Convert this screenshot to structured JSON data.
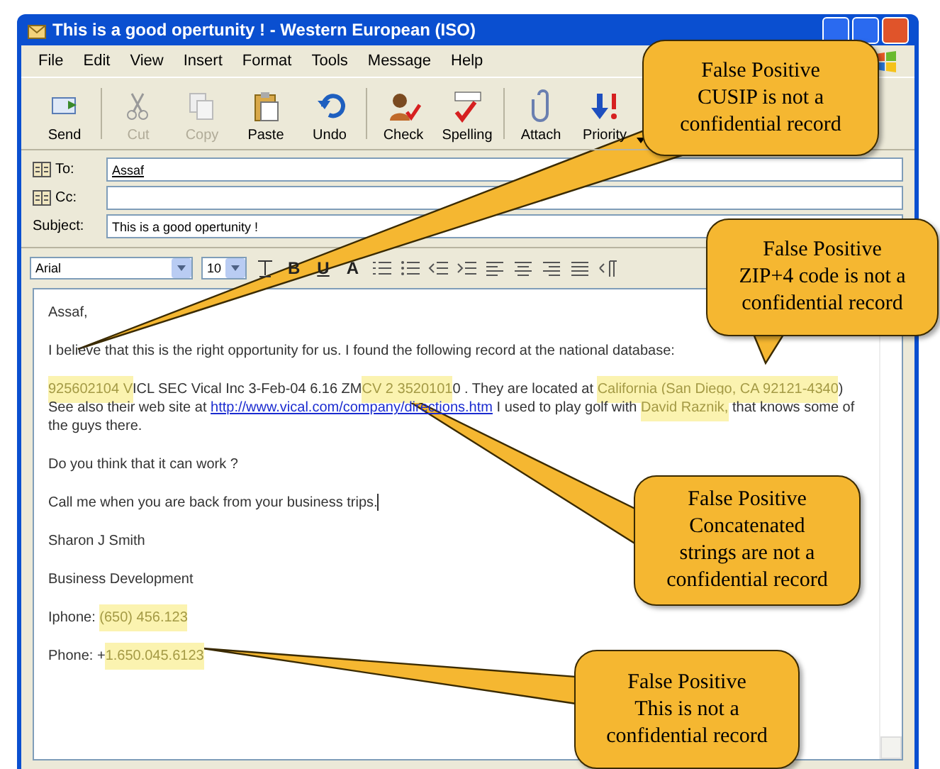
{
  "window": {
    "title": "This is a good opertunity ! - Western European (ISO)"
  },
  "menu": [
    "File",
    "Edit",
    "View",
    "Insert",
    "Format",
    "Tools",
    "Message",
    "Help"
  ],
  "toolbar": [
    {
      "label": "Send",
      "disabled": false,
      "separator_before": false
    },
    {
      "label": "Cut",
      "disabled": true,
      "separator_before": true
    },
    {
      "label": "Copy",
      "disabled": true,
      "separator_before": false
    },
    {
      "label": "Paste",
      "disabled": false,
      "separator_before": false
    },
    {
      "label": "Undo",
      "disabled": false,
      "separator_before": false
    },
    {
      "label": "Check",
      "disabled": false,
      "separator_before": true
    },
    {
      "label": "Spelling",
      "disabled": false,
      "separator_before": false
    },
    {
      "label": "Attach",
      "disabled": false,
      "separator_before": true
    },
    {
      "label": "Priority",
      "disabled": false,
      "separator_before": false,
      "dropdown": true
    }
  ],
  "header": [
    {
      "label": "To:",
      "value": "Assaf",
      "book": true
    },
    {
      "label": "Cc:",
      "book": true
    },
    {
      "label": "Subject:",
      "value": "This is a good opertunity !",
      "book": false
    }
  ],
  "format_bar": {
    "font": "Arial",
    "size": "10",
    "buttons": [
      "B",
      "U",
      "A"
    ]
  },
  "body": [
    {
      "lines": [
        [
          {
            "kind": "text",
            "text": "Assaf,"
          }
        ]
      ]
    },
    {
      "lines": [
        [
          {
            "kind": "text",
            "text": "I believe that this is the right opportunity for us. I found the following record at the national database:"
          }
        ]
      ]
    },
    {
      "lines": [
        [
          {
            "kind": "highlight",
            "text": "925602104 V"
          },
          {
            "kind": "text",
            "text": "ICL SEC Vical Inc 3-Feb-04 6.16 ZM"
          },
          {
            "kind": "highlight",
            "text": "CV 2 3520101"
          },
          {
            "kind": "text",
            "text": "0 . They are located at "
          },
          {
            "kind": "highlight",
            "text": "California (San Diego, CA 92121-4340"
          },
          {
            "kind": "text",
            "text": ")"
          }
        ],
        [
          {
            "kind": "text",
            "text": "See also their web site at "
          },
          {
            "kind": "link",
            "text": "http://www.vical.com/company/directions.htm"
          },
          {
            "kind": "text",
            "text": " I used to play golf with "
          },
          {
            "kind": "highlight",
            "text": "David Raznik,"
          },
          {
            "kind": "text",
            "text": " that knows some of the guys there."
          }
        ]
      ]
    },
    {
      "lines": [
        [
          {
            "kind": "text",
            "text": "Do you think that it can work ?"
          }
        ]
      ]
    },
    {
      "lines": [
        [
          {
            "kind": "text",
            "text": "Call me when you are back from your business trips."
          },
          {
            "kind": "cursor"
          }
        ]
      ]
    },
    {
      "lines": [
        [
          {
            "kind": "text",
            "text": "Sharon J Smith"
          }
        ]
      ]
    },
    {
      "lines": [
        [
          {
            "kind": "text",
            "text": "Business Development"
          }
        ]
      ]
    },
    {
      "lines": [
        [
          {
            "kind": "text",
            "text": "Iphone: "
          },
          {
            "kind": "highlight",
            "text": "(650) 456.123"
          }
        ]
      ]
    },
    {
      "lines": [
        [
          {
            "kind": "text",
            "text": "Phone: +"
          },
          {
            "kind": "highlight",
            "text": "1.650.045.6123"
          }
        ]
      ]
    }
  ],
  "callouts": [
    {
      "text": "False Positive\nCUSIP is not a\nconfidential record"
    },
    {
      "text": "False Positive\nZIP+4 code is not a\nconfidential record"
    },
    {
      "text": "False Positive\nConcatenated\nstrings are not a\nconfidential record"
    },
    {
      "text": "False Positive\nThis is not a\nconfidential record"
    }
  ]
}
